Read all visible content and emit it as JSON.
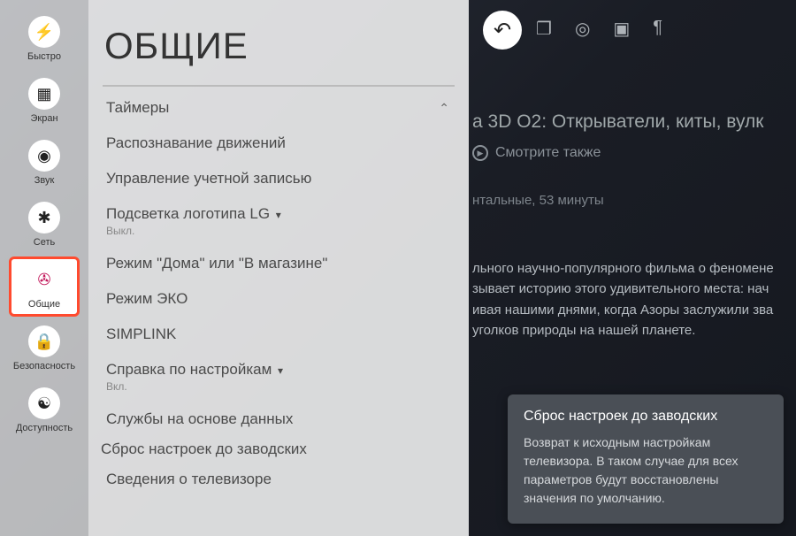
{
  "sidebar": {
    "items": [
      {
        "label": "Быстро",
        "icon": "⚡"
      },
      {
        "label": "Экран",
        "icon": "▦"
      },
      {
        "label": "Звук",
        "icon": "◉"
      },
      {
        "label": "Сеть",
        "icon": "✱"
      },
      {
        "label": "Общие",
        "icon": "✇"
      },
      {
        "label": "Безопасность",
        "icon": "🔒"
      },
      {
        "label": "Доступность",
        "icon": "☯"
      }
    ],
    "selected_index": 4
  },
  "panel": {
    "title": "ОБЩИЕ",
    "rows": [
      {
        "label": "Таймеры"
      },
      {
        "label": "Распознавание движений"
      },
      {
        "label": "Управление учетной записью"
      },
      {
        "label": "Подсветка логотипа LG",
        "expand": "▾",
        "sub": "Выкл."
      },
      {
        "label": "Режим \"Дома\" или \"В магазине\""
      },
      {
        "label": "Режим ЭКО"
      },
      {
        "label": "SIMPLINK"
      },
      {
        "label": "Справка по настройкам",
        "expand": "▾",
        "sub": "Вкл."
      },
      {
        "label": "Службы на основе данных"
      },
      {
        "label": "Сброс настроек до заводских",
        "selected": true
      },
      {
        "label": "Сведения о телевизоре"
      }
    ],
    "scroll_up_glyph": "⌃"
  },
  "content": {
    "top_icons": [
      "❐",
      "◎",
      "▣",
      "¶"
    ],
    "title": "а 3D O2: Открыватели, киты, вулк",
    "see_also": "Смотрите также",
    "meta": "нтальные, 53 минуты",
    "description": "льного научно-популярного фильма о феномене зывает историю этого удивительного места: нач ивая нашими днями, когда Азоры заслужили зва уголков природы на нашей планете."
  },
  "tooltip": {
    "title": "Сброс настроек до заводских",
    "body": "Возврат к исходным настройкам телевизора. В таком случае для всех параметров будут восстановлены значения по умолчанию."
  }
}
